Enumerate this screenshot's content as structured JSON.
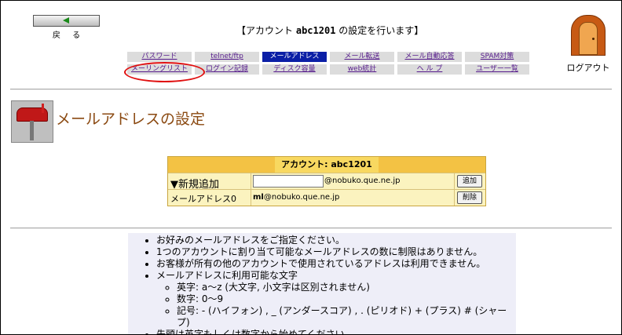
{
  "back": {
    "label": "戻 る"
  },
  "header": {
    "title_prefix": "【アカウント",
    "account": "abc1201",
    "title_suffix": "の設定を行います】"
  },
  "logout": {
    "label": "ログアウト"
  },
  "nav": {
    "row1": [
      "パスワード",
      "telnet/ftp",
      "メールアドレス",
      "メール転送",
      "メール自動応答",
      "SPAM対策"
    ],
    "row2": [
      "メーリングリスト",
      "ログイン記録",
      "ディスク容量",
      "web統計",
      "ヘ ル プ",
      "ユーザー一覧"
    ],
    "active": "メールアドレス"
  },
  "page": {
    "title": "メールアドレスの設定"
  },
  "account_table": {
    "header": "アカウント: abc1201",
    "new_row": {
      "label": "▼新規追加",
      "domain": "@nobuko.que.ne.jp",
      "add_button": "追加",
      "input_value": ""
    },
    "existing_row": {
      "label": "メールアドレス0",
      "address_user": "ml",
      "address_domain": "@nobuko.que.ne.jp",
      "delete_button": "削除"
    }
  },
  "info": {
    "items": [
      "お好みのメールアドレスをご指定ください。",
      "1つのアカウントに割り当て可能なメールアドレスの数に制限はありません。",
      "お客様が所有の他のアカウントで使用されているアドレスは利用できません。",
      "メールアドレスに利用可能な文字"
    ],
    "sub_items": [
      "英字: a～z (大文字, 小文字は区別されません)",
      "数字: 0～9",
      "記号: - (ハイフォン) , _ (アンダースコア) , . (ピリオド) + (プラス) # (シャープ)"
    ],
    "last_item": "先頭は英字もしくは数字から始めてください。"
  }
}
